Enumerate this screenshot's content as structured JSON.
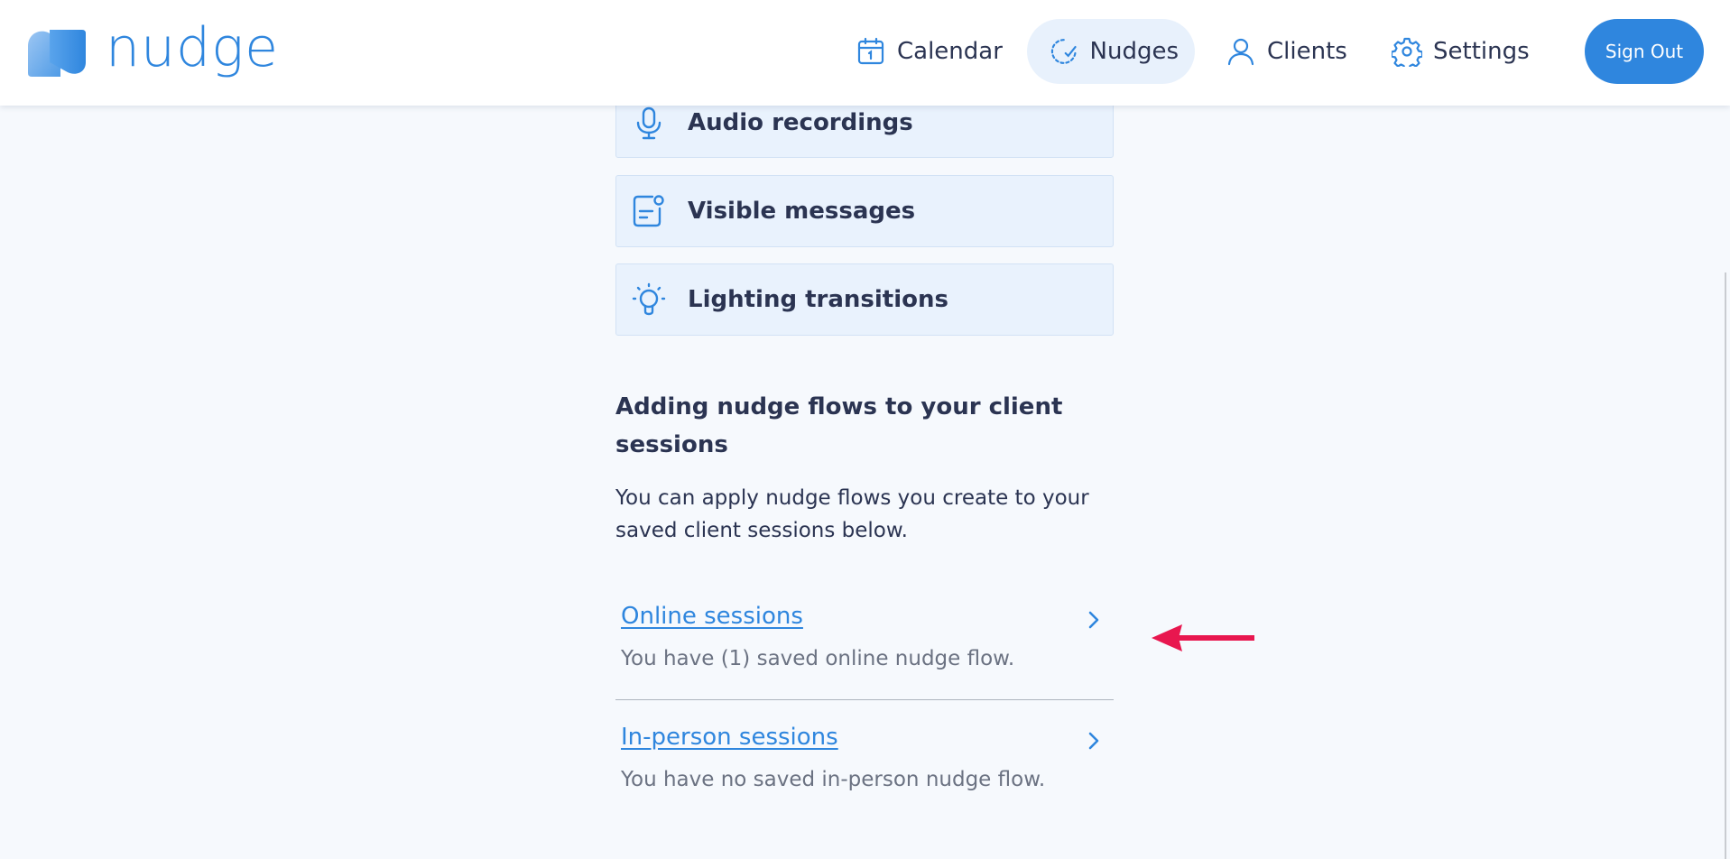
{
  "header": {
    "brand": "nudge",
    "nav": [
      {
        "label": "Calendar",
        "icon": "calendar-icon"
      },
      {
        "label": "Nudges",
        "icon": "nudges-icon",
        "active": true
      },
      {
        "label": "Clients",
        "icon": "user-icon"
      },
      {
        "label": "Settings",
        "icon": "gear-icon"
      }
    ],
    "sign_out": "Sign Out"
  },
  "features": [
    {
      "label": "Audio recordings",
      "icon": "microphone-icon"
    },
    {
      "label": "Visible messages",
      "icon": "message-icon"
    },
    {
      "label": "Lighting transitions",
      "icon": "lightbulb-icon"
    }
  ],
  "section": {
    "title": "Adding nudge flows to your client sessions",
    "description": "You can apply nudge flows you create to your saved client sessions below."
  },
  "sessions": [
    {
      "title": "Online sessions",
      "subtitle": "You have (1) saved online nudge flow."
    },
    {
      "title": "In-person sessions",
      "subtitle": "You have no saved in-person nudge flow."
    }
  ],
  "colors": {
    "accent": "#2f86de",
    "annotation_arrow": "#e8174f",
    "background": "#f6f9fd",
    "text": "#2b3452"
  }
}
